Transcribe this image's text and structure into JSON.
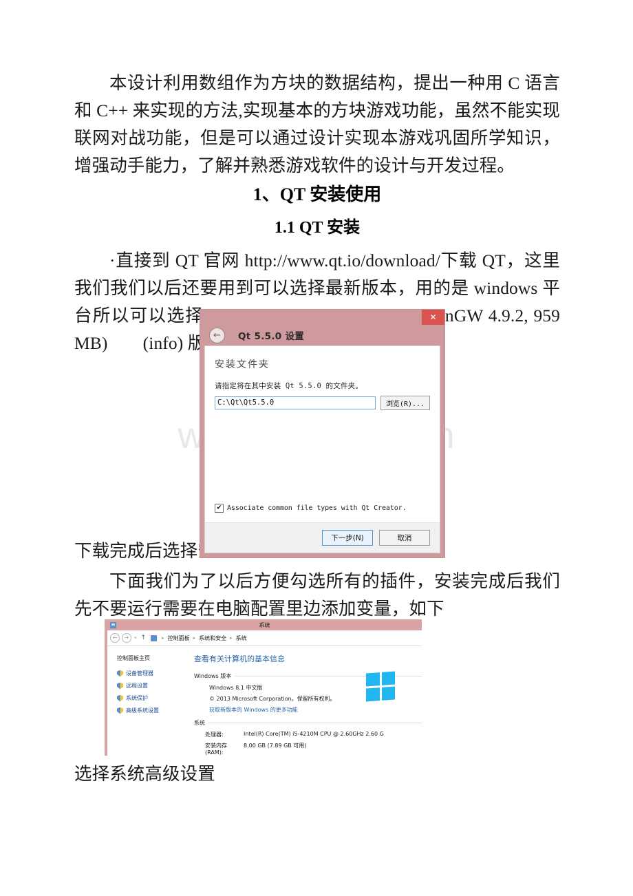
{
  "document": {
    "paragraph_1": "本设计利用数组作为方块的数据结构，提出一种用 C 语言和 C++ 来实现的方法,实现基本的方块游戏功能，虽然不能实现联网对战功能，但是可以通过设计实现本游戏巩固所学知识，增强动手能力，了解并熟悉游戏软件的设计与开发过程。",
    "heading_1": "1、QT 安装使用",
    "heading_2": "1.1 QT 安装",
    "paragraph_2": "·直接到 QT 官网 http://www.qt.io/download/下载 QT，这里我们我们以后还要用到可以选择最新版本，用的是 windows 平台所以可以选择 Qt 5.5.0 for Windows 32-bit (MinGW 4.9.2, 959 MB)　　(info) 版本，",
    "caption_1": "下载完成后选择安装",
    "paragraph_3": "下面我们为了以后方便勾选所有的插件，安装完成后我们先不要运行需要在电脑配置里边添加变量，如下",
    "caption_2": "选择系统高级设置",
    "watermark": "www.bdocx.com"
  },
  "qt_installer": {
    "close_label": "✕",
    "back_label": "←",
    "title": "Qt 5.5.0 设置",
    "section_heading": "安装文件夹",
    "instruction": "请指定将在其中安装 Qt 5.5.0 的文件夹。",
    "path_value": "C:\\Qt\\Qt5.5.0",
    "browse_label": "浏览(R)...",
    "checkbox_mark": "✔",
    "checkbox_label": "Associate common file types with Qt Creator.",
    "next_label": "下一步(N)",
    "cancel_label": "取消",
    "frame_color": "#ce9a9d",
    "close_color": "#d9534f"
  },
  "system_panel": {
    "window_title": "系统",
    "breadcrumb": [
      "控制面板",
      "系统和安全",
      "系统"
    ],
    "breadcrumb_separator": "▸",
    "nav_back": "←",
    "nav_forward": "→",
    "nav_caret": "▾",
    "nav_up": "↑",
    "sidebar_heading": "控制面板主页",
    "sidebar_links": [
      "设备管理器",
      "远程设置",
      "系统保护",
      "高级系统设置"
    ],
    "content_heading": "查看有关计算机的基本信息",
    "windows_section": "Windows 版本",
    "windows_edition": "Windows 8.1 中文版",
    "copyright": "© 2013 Microsoft Corporation。保留所有权利。",
    "more_features_link": "获取新版本的 Windows 的更多功能",
    "system_section": "系统",
    "rows": [
      {
        "key": "处理器:",
        "value": "Intel(R) Core(TM) i5-4210M CPU @ 2.60GHz   2.60 G"
      },
      {
        "key": "安装内存(RAM):",
        "value": "8.00 GB (7.89 GB 可用)"
      }
    ],
    "title_bar_color": "#d8a3a3",
    "link_color": "#1b4b8f",
    "heading_color": "#2a64a8",
    "logo_color": "#21b6ef"
  }
}
